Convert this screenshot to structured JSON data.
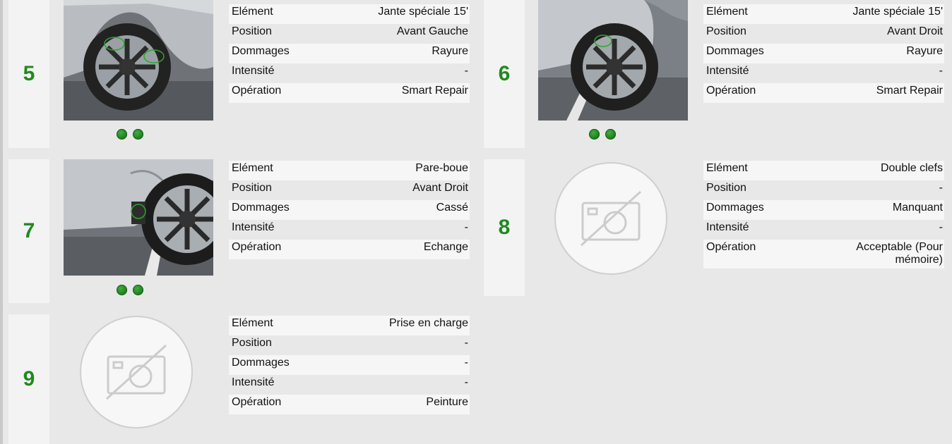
{
  "labels": {
    "element": "Elément",
    "position": "Position",
    "dommages": "Dommages",
    "intensite": "Intensité",
    "operation": "Opération"
  },
  "items": [
    {
      "number": "5",
      "photo_icon": "car-front-left-wheel-photo",
      "dots": 2,
      "element": "Jante spéciale 15'",
      "position": "Avant Gauche",
      "dommages": "Rayure",
      "intensite": "-",
      "operation": "Smart Repair"
    },
    {
      "number": "6",
      "photo_icon": "car-front-right-wheel-photo",
      "dots": 2,
      "element": "Jante spéciale 15'",
      "position": "Avant Droit",
      "dommages": "Rayure",
      "intensite": "-",
      "operation": "Smart Repair"
    },
    {
      "number": "7",
      "photo_icon": "car-mudguard-photo",
      "dots": 2,
      "element": "Pare-boue",
      "position": "Avant Droit",
      "dommages": "Cassé",
      "intensite": "-",
      "operation": "Echange"
    },
    {
      "number": "8",
      "photo_icon": "no-photo-icon",
      "dots": 0,
      "element": "Double clefs",
      "position": "-",
      "dommages": "Manquant",
      "intensite": "-",
      "operation": "Acceptable (Pour mémoire)"
    },
    {
      "number": "9",
      "photo_icon": "no-photo-icon",
      "dots": 0,
      "element": "Prise en charge",
      "position": "-",
      "dommages": "-",
      "intensite": "-",
      "operation": "Peinture"
    }
  ],
  "colors": {
    "number": "#1f8a1f",
    "dot": "#1d7a1d",
    "background": "#e8e8e8"
  }
}
